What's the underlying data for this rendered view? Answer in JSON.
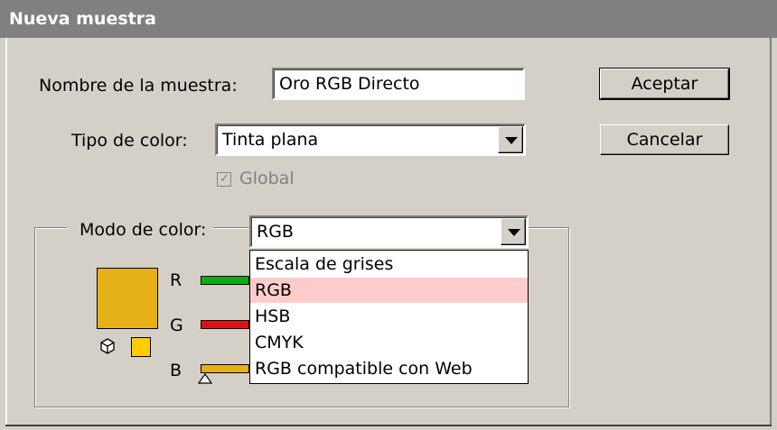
{
  "window": {
    "title": "Nueva muestra"
  },
  "form": {
    "name_label": "Nombre de la muestra:",
    "name_value": "Oro RGB Directo",
    "type_label": "Tipo de color:",
    "type_value": "Tinta plana",
    "global_label": "Global",
    "global_checked": true,
    "mode_label": "Modo de color:",
    "mode_value": "RGB"
  },
  "buttons": {
    "ok": "Aceptar",
    "cancel": "Cancelar"
  },
  "sliders": {
    "r_label": "R",
    "g_label": "G",
    "b_label": "B"
  },
  "swatch": {
    "color": "#e6b019",
    "web_color": "#ffcc00"
  },
  "mode_options": [
    "Escala de grises",
    "RGB",
    "HSB",
    "CMYK",
    "RGB compatible con Web"
  ],
  "selected_mode_index": 1,
  "colors": {
    "titlebar": "#808080",
    "dialog_bg": "#d4d0c8",
    "highlight": "#ffcccc"
  }
}
